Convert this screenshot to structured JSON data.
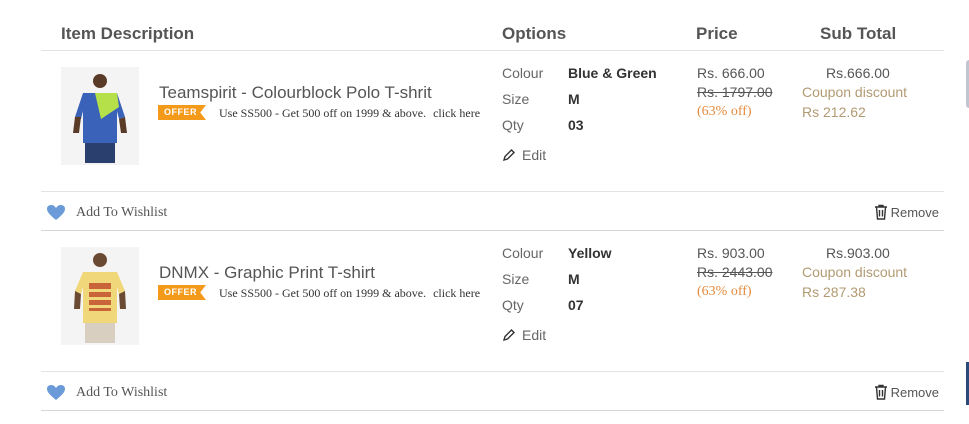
{
  "header": {
    "item_description": "Item Description",
    "options": "Options",
    "price": "Price",
    "sub_total": "Sub Total"
  },
  "items": [
    {
      "name": "Teamspirit - Colourblock Polo T-shrit",
      "offer_badge": "OFFER",
      "promo_text": "Use SS500 - Get 500 off on 1999 & above.",
      "promo_link": "click here",
      "options": [
        {
          "label": "Colour",
          "value": "Blue & Green"
        },
        {
          "label": "Size",
          "value": "M"
        },
        {
          "label": "Qty",
          "value": "03"
        }
      ],
      "edit_label": "Edit",
      "price": "Rs. 666.00",
      "original_price": "Rs. 1797.00",
      "discount_pct": "(63% off)",
      "subtotal": "Rs.666.00",
      "coupon_label": "Coupon discount",
      "coupon_amount": "Rs 212.62",
      "wishlist_label": "Add To Wishlist",
      "remove_label": "Remove",
      "shirt_color": "#3a62b8"
    },
    {
      "name": "DNMX - Graphic Print T-shirt",
      "offer_badge": "OFFER",
      "promo_text": "Use SS500 - Get 500 off on 1999 & above.",
      "promo_link": "click here",
      "options": [
        {
          "label": "Colour",
          "value": "Yellow"
        },
        {
          "label": "Size",
          "value": "M"
        },
        {
          "label": "Qty",
          "value": "07"
        }
      ],
      "edit_label": "Edit",
      "price": "Rs. 903.00",
      "original_price": "Rs. 2443.00",
      "discount_pct": "(63% off)",
      "subtotal": "Rs.903.00",
      "coupon_label": "Coupon discount",
      "coupon_amount": "Rs 287.38",
      "wishlist_label": "Add To Wishlist",
      "remove_label": "Remove",
      "shirt_color": "#efd77a"
    }
  ],
  "icons": {
    "edit": "pencil-icon",
    "wishlist": "heart-icon",
    "remove": "trash-icon",
    "offer": "offer-tag-icon"
  },
  "colors": {
    "offer_badge": "#f39a1b",
    "discount": "#e58a3c",
    "coupon": "#b29a72",
    "heart": "#6a9bd8"
  }
}
